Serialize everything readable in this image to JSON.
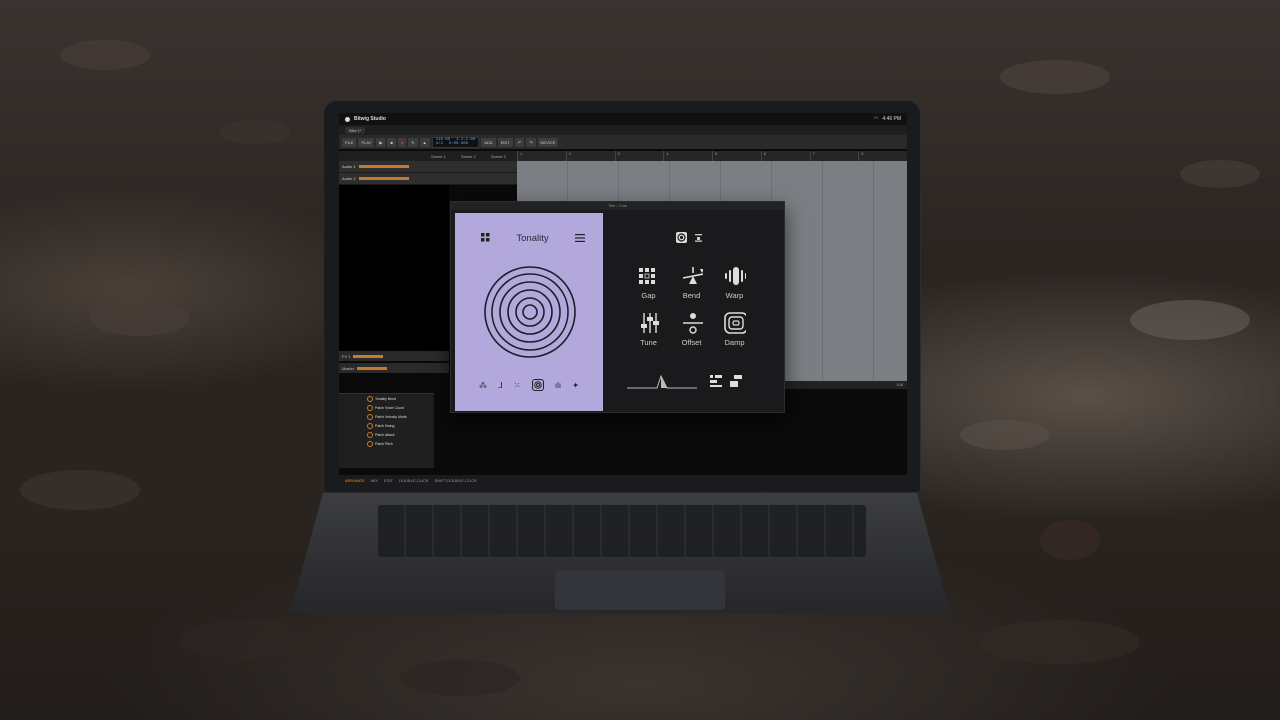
{
  "menubar": {
    "app_name": "Bitwig Studio",
    "time": "4:46 PM"
  },
  "daw": {
    "tab_label": "Bitw 1*",
    "toolbar": [
      "FILE",
      "PLAY",
      "ADD",
      "EDIT",
      "DEVICE"
    ],
    "transport": {
      "tempo": "110.00",
      "position": "1.1.1.00",
      "signature": "4/4",
      "time": "0:00.000"
    },
    "scenes": [
      "Scene 1",
      "Scene 2",
      "Scene 3"
    ],
    "ruler": [
      "1",
      "2",
      "3",
      "4",
      "5",
      "6",
      "7",
      "8"
    ],
    "tracks": [
      "Audio 1",
      "Audio 2"
    ],
    "lower_tracks": [
      "FX 1",
      "Master"
    ],
    "device_params": [
      "Tonality Bend",
      "Patch Voice Count",
      "Patch Velocity Mode",
      "Patch Swing",
      "Patch Attack",
      "Patch Pitch"
    ],
    "status": {
      "arrange": "ARRANGE",
      "mix": "MIX",
      "edit": "EDIT",
      "hint1": "DOUBLE-CLICK",
      "hint2": "SHIFT-DOUBLE-CLICK"
    },
    "zoom": "1/16"
  },
  "plugin": {
    "window_title": "Title / Tone",
    "title": "Tonality",
    "effects": [
      {
        "name": "Gap",
        "icon": "gap-icon"
      },
      {
        "name": "Bend",
        "icon": "bend-icon"
      },
      {
        "name": "Warp",
        "icon": "warp-icon"
      },
      {
        "name": "Tune",
        "icon": "tune-icon"
      },
      {
        "name": "Offset",
        "icon": "offset-icon"
      },
      {
        "name": "Damp",
        "icon": "damp-icon"
      }
    ],
    "colors": {
      "panel": "#b2a8dc",
      "bg": "#1a1a1c",
      "accent": "#dddddd"
    }
  }
}
